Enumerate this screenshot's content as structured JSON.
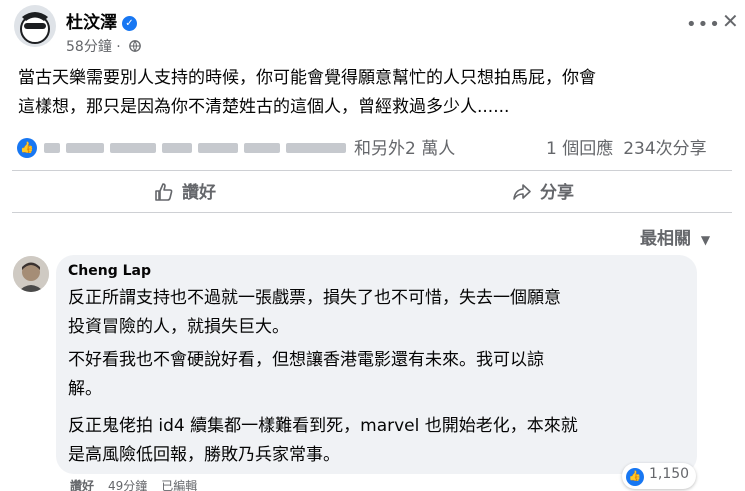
{
  "post": {
    "author": "杜汶澤",
    "time": "58分鐘",
    "text_line1": "當古天樂需要別人支持的時候，你可能會覺得願意幫忙的人只想拍馬屁，你會",
    "text_line2": "這樣想，那只是因為你不清楚姓古的這個人，曾經救過多少人......"
  },
  "reactions": {
    "reactors_tail": "和另外2 萬人",
    "comments": "1 個回應",
    "shares": "234次分享"
  },
  "actions": {
    "like_label": "讚好",
    "share_label": "分享"
  },
  "sort": {
    "label": "最相關"
  },
  "comment": {
    "author": "Cheng Lap",
    "para1_line1": "反正所謂支持也不過就一張戲票，損失了也不可惜，失去一個願意",
    "para1_line2": "投資冒險的人，就損失巨大。",
    "para2_line1": "不好看我也不會硬說好看，但想讓香港電影還有未來。我可以諒",
    "para2_line2": "解。",
    "para3_line1": "反正鬼佬拍 id4 續集都一樣難看到死，marvel 也開始老化，本來就",
    "para3_line2": "是高風險低回報，勝敗乃兵家常事。",
    "like_count": "1,150",
    "like_action": "讚好",
    "time": "49分鐘",
    "edited": "已編輯"
  },
  "colors": {
    "accent": "#1877f2",
    "secondary_text": "#65676b",
    "bubble": "#f0f2f5"
  }
}
